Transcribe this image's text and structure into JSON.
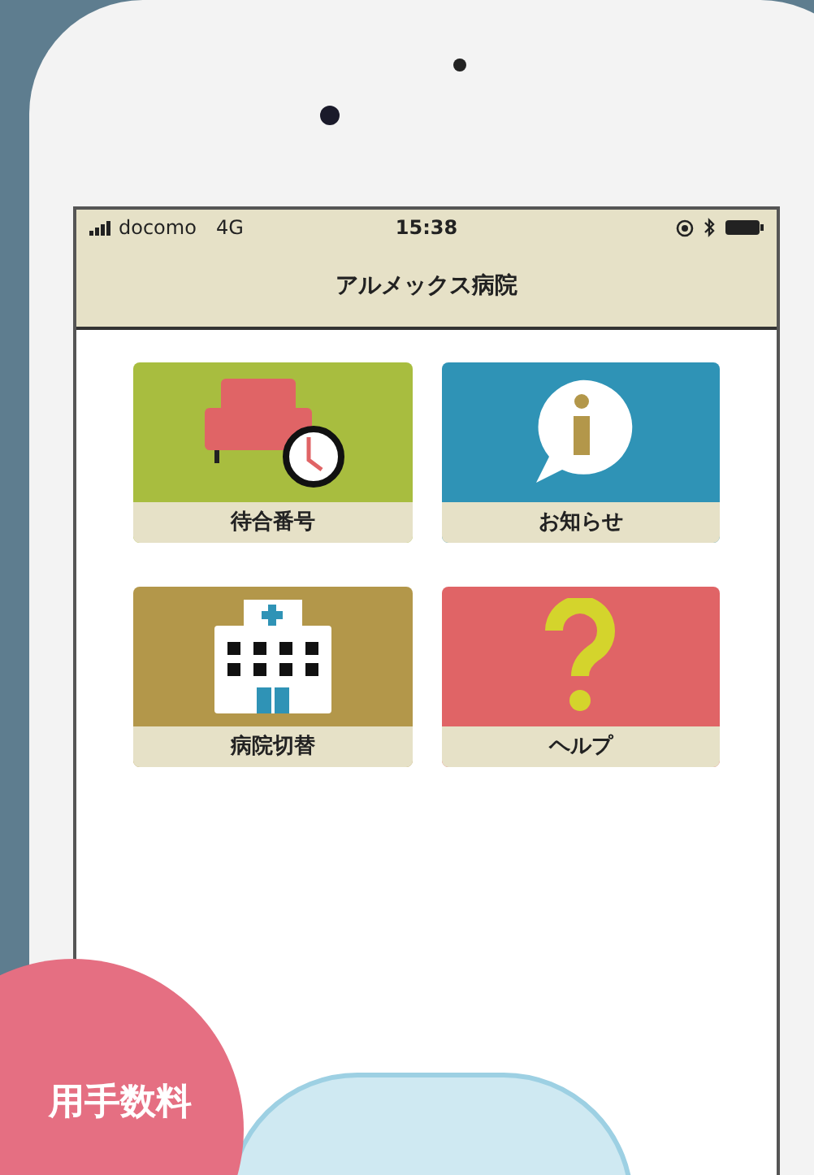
{
  "status_bar": {
    "carrier": "docomo",
    "network": "4G",
    "time": "15:38"
  },
  "nav": {
    "title": "アルメックス病院"
  },
  "tiles": [
    {
      "kind": "waiting",
      "label": "待合番号",
      "color": "#a8bd3f"
    },
    {
      "kind": "info",
      "label": "お知らせ",
      "color": "#2f93b6"
    },
    {
      "kind": "hospital",
      "label": "病院切替",
      "color": "#b3974a"
    },
    {
      "kind": "help",
      "label": "ヘルプ",
      "color": "#e06466"
    }
  ],
  "badge": {
    "text": "用手数料"
  }
}
